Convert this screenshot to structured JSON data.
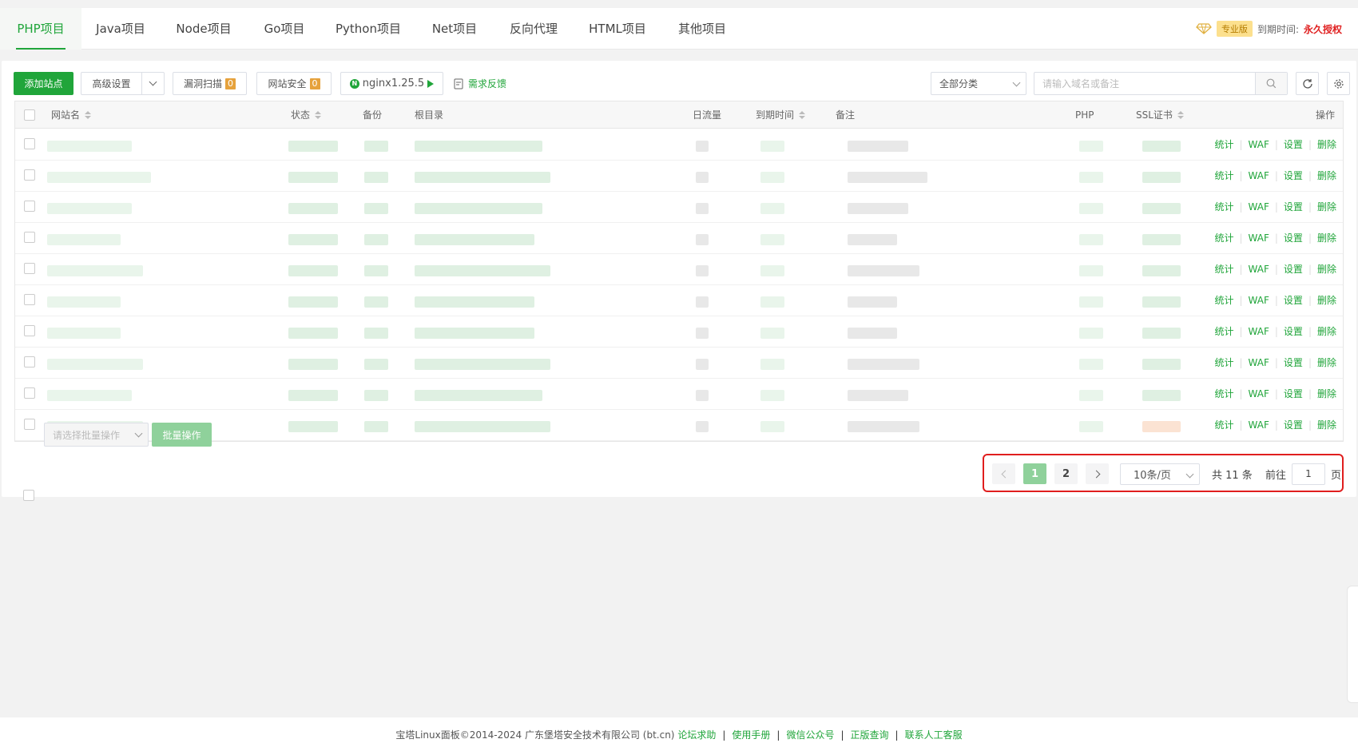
{
  "tabs": [
    {
      "label": "PHP项目",
      "active": true
    },
    {
      "label": "Java项目"
    },
    {
      "label": "Node项目"
    },
    {
      "label": "Go项目"
    },
    {
      "label": "Python项目"
    },
    {
      "label": "Net项目"
    },
    {
      "label": "反向代理"
    },
    {
      "label": "HTML项目"
    },
    {
      "label": "其他项目"
    }
  ],
  "license": {
    "badge": "专业版",
    "expire_label": "到期时间:",
    "expire_value": "永久授权"
  },
  "toolbar": {
    "add_site": "添加站点",
    "advanced": "高级设置",
    "vuln_scan": "漏洞扫描",
    "vuln_count": "0",
    "site_security": "网站安全",
    "security_count": "0",
    "nginx": "nginx1.25.5",
    "feedback": "需求反馈",
    "category": "全部分类",
    "search_placeholder": "请输入域名或备注"
  },
  "columns": {
    "name": "网站名",
    "status": "状态",
    "backup": "备份",
    "root": "根目录",
    "traffic": "日流量",
    "expire": "到期时间",
    "remark": "备注",
    "php": "PHP",
    "ssl": "SSL证书",
    "ops": "操作"
  },
  "row_actions": {
    "stats": "统计",
    "waf": "WAF",
    "settings": "设置",
    "delete": "删除"
  },
  "batch": {
    "placeholder": "请选择批量操作",
    "button": "批量操作"
  },
  "pagination": {
    "pages": [
      "1",
      "2"
    ],
    "current": "1",
    "per_page": "10条/页",
    "total": "共 11 条",
    "goto_label": "前往",
    "goto_value": "1",
    "page_suffix": "页"
  },
  "footer": {
    "copyright": "宝塔Linux面板©2014-2024 广东堡塔安全技术有限公司 (bt.cn)",
    "links": [
      "论坛求助",
      "使用手册",
      "微信公众号",
      "正版查询",
      "联系人工客服"
    ]
  },
  "colors": {
    "brand": "#20a53a",
    "warning": "#e6a23c",
    "danger": "#e01e1e"
  }
}
